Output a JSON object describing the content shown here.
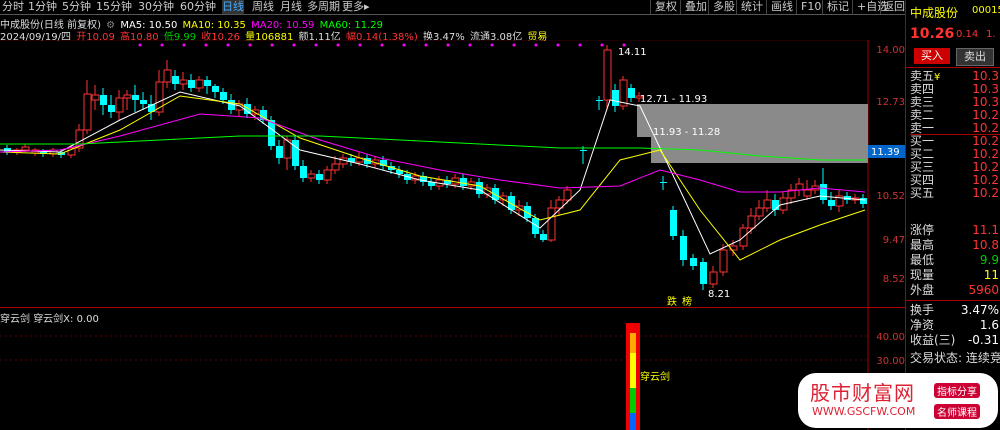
{
  "topbar": {
    "tabs": [
      "分时",
      "1分钟",
      "5分钟",
      "15分钟",
      "30分钟",
      "60分钟",
      "日线",
      "周线",
      "月线",
      "多周期",
      "更多"
    ],
    "active_tab": "日线",
    "right_buttons": [
      "复权",
      "叠加",
      "多股",
      "统计",
      "画线",
      "F10",
      "标记",
      "+自选",
      "返回"
    ]
  },
  "info_line1": {
    "name": "中成股份(日线 前复权)",
    "ma5": "MA5: 10.50",
    "ma10": "MA10: 10.35",
    "ma20": "MA20: 10.59",
    "ma60": "MA60: 11.29"
  },
  "info_line2": {
    "date": "2024/09/19/四",
    "open": "开10.09",
    "high": "高10.80",
    "low": "低9.99",
    "close": "收10.26",
    "volume": "量106881",
    "amount": "额1.11亿",
    "change": "幅0.14(1.38%)",
    "turnover": "换3.47%",
    "float": "流通3.08亿",
    "sector": "贸易"
  },
  "chart_annotations": {
    "high_label": "14.11",
    "low_label": "8.21",
    "range1": "12.71 - 11.93",
    "range2": "11.93 - 11.28",
    "current_price_tag": "11.39",
    "tag_die": "跌",
    "tag_bang": "榜"
  },
  "y_axis_main": [
    "14.00",
    "12.73",
    "10.52",
    "9.47",
    "8.52"
  ],
  "sub_chart": {
    "title": "穿云剑",
    "value_label": "穿云剑X: 0.00",
    "signal_text": "穿云剑",
    "y_axis": [
      "40.00",
      "30.00"
    ]
  },
  "right_panel": {
    "stock_name": "中成股份",
    "stock_code": "00015",
    "price": "10.26",
    "change": "0.14",
    "change_pct": "1.",
    "buy_label": "买入",
    "sell_label": "卖出",
    "order_book": [
      {
        "label": "卖五",
        "mark": "¥",
        "val": "10.3"
      },
      {
        "label": "卖四",
        "mark": "",
        "val": "10.3"
      },
      {
        "label": "卖三",
        "mark": "",
        "val": "10.3"
      },
      {
        "label": "卖二",
        "mark": "",
        "val": "10.2"
      },
      {
        "label": "卖一",
        "mark": "",
        "val": "10.2"
      },
      {
        "label": "买一",
        "mark": "",
        "val": "10.2"
      },
      {
        "label": "买二",
        "mark": "",
        "val": "10.2"
      },
      {
        "label": "买三",
        "mark": "",
        "val": "10.2"
      },
      {
        "label": "买四",
        "mark": "",
        "val": "10.2"
      },
      {
        "label": "买五",
        "mark": "",
        "val": "10.2"
      }
    ],
    "stats": [
      {
        "label": "涨停",
        "val": "11.1"
      },
      {
        "label": "最高",
        "val": "10.8"
      },
      {
        "label": "最低",
        "val": "9.9"
      },
      {
        "label": "现量",
        "val": "11"
      },
      {
        "label": "外盘",
        "val": "5960"
      }
    ],
    "stats2": [
      {
        "label": "换手",
        "val": "3.47%"
      },
      {
        "label": "净资",
        "val": "1.6"
      },
      {
        "label": "收益(三)",
        "val": "-0.31"
      }
    ],
    "trade_status": "交易状态: 连续竞"
  },
  "watermark": {
    "site_name": "股市财富网",
    "url": "WWW.GSCFW.COM",
    "tag1": "指标分享",
    "tag2": "名师课程"
  },
  "colors": {
    "up": "#ff3232",
    "down": "#00ffff",
    "ma5": "#ffffff",
    "ma10": "#ffff00",
    "ma20": "#ff00ff",
    "ma60": "#00ff00"
  }
}
